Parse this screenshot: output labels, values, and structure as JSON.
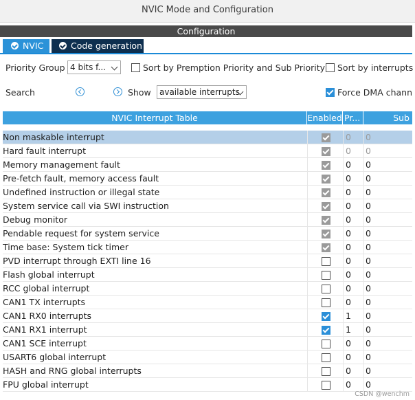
{
  "window": {
    "title": "NVIC Mode and Configuration"
  },
  "section": {
    "title": "Configuration"
  },
  "tabs": [
    {
      "label": "NVIC",
      "active": true
    },
    {
      "label": "Code generation",
      "active": false
    }
  ],
  "options": {
    "priority_group_label": "Priority Group",
    "priority_group_value": "4 bits f...",
    "sort_preemption_label": "Sort by Premption Priority and Sub Priority",
    "sort_preemption_checked": false,
    "sort_interrupts_label": "Sort by interrupts",
    "sort_interrupts_checked": false,
    "search_label": "Search",
    "show_label": "Show",
    "show_value": "available interrupts",
    "force_dma_label": "Force DMA chann",
    "force_dma_checked": true
  },
  "table": {
    "columns": [
      "NVIC Interrupt Table",
      "Enabled",
      "Pr...",
      "Sub"
    ],
    "rows": [
      {
        "name": "Non maskable interrupt",
        "enabled": true,
        "locked": true,
        "priority": "0",
        "sub": "0",
        "selected": true,
        "muted": true
      },
      {
        "name": "Hard fault interrupt",
        "enabled": true,
        "locked": true,
        "priority": "0",
        "sub": "0",
        "muted": true
      },
      {
        "name": "Memory management fault",
        "enabled": true,
        "locked": true,
        "priority": "0",
        "sub": "0"
      },
      {
        "name": "Pre-fetch fault, memory access fault",
        "enabled": true,
        "locked": true,
        "priority": "0",
        "sub": "0"
      },
      {
        "name": "Undefined instruction or illegal state",
        "enabled": true,
        "locked": true,
        "priority": "0",
        "sub": "0"
      },
      {
        "name": "System service call via SWI instruction",
        "enabled": true,
        "locked": true,
        "priority": "0",
        "sub": "0"
      },
      {
        "name": "Debug monitor",
        "enabled": true,
        "locked": true,
        "priority": "0",
        "sub": "0"
      },
      {
        "name": "Pendable request for system service",
        "enabled": true,
        "locked": true,
        "priority": "0",
        "sub": "0"
      },
      {
        "name": "Time base: System tick timer",
        "enabled": true,
        "locked": true,
        "priority": "0",
        "sub": "0"
      },
      {
        "name": "PVD interrupt through EXTI line 16",
        "enabled": false,
        "priority": "0",
        "sub": "0"
      },
      {
        "name": "Flash global interrupt",
        "enabled": false,
        "priority": "0",
        "sub": "0"
      },
      {
        "name": "RCC global interrupt",
        "enabled": false,
        "priority": "0",
        "sub": "0"
      },
      {
        "name": "CAN1 TX interrupts",
        "enabled": false,
        "priority": "0",
        "sub": "0"
      },
      {
        "name": "CAN1 RX0 interrupts",
        "enabled": true,
        "priority": "1",
        "sub": "0"
      },
      {
        "name": "CAN1 RX1 interrupt",
        "enabled": true,
        "priority": "1",
        "sub": "0"
      },
      {
        "name": "CAN1 SCE interrupt",
        "enabled": false,
        "priority": "0",
        "sub": "0"
      },
      {
        "name": "USART6 global interrupt",
        "enabled": false,
        "priority": "0",
        "sub": "0"
      },
      {
        "name": "HASH and RNG global interrupts",
        "enabled": false,
        "priority": "0",
        "sub": "0"
      },
      {
        "name": "FPU global interrupt",
        "enabled": false,
        "priority": "0",
        "sub": "0"
      }
    ]
  },
  "watermark": "CSDN @wenchm"
}
